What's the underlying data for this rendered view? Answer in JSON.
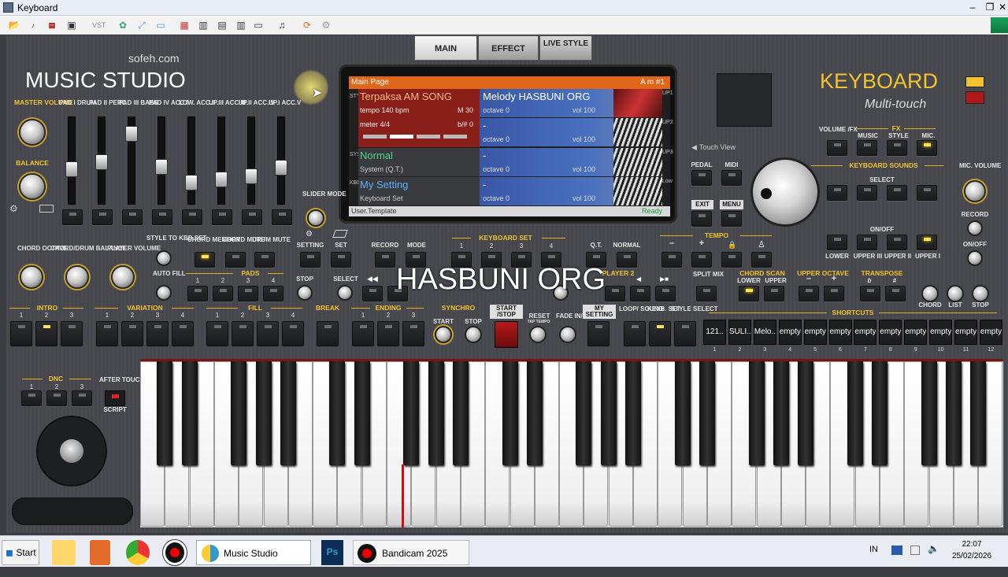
{
  "window": {
    "title": "Keyboard",
    "minimize": "–",
    "restore": "❐",
    "close": "✕"
  },
  "toolbar": {
    "vst": "VST"
  },
  "branding": {
    "site": "sofeh.com",
    "app": "MUSIC STUDIO",
    "keyboard": "KEYBOARD",
    "multitouch": "Multi-touch"
  },
  "tabs": {
    "main": "MAIN",
    "effect": "EFFECT",
    "live_style": "LIVE STYLE"
  },
  "screen": {
    "header": "Main Page",
    "chord": "A m  #1",
    "style_name": "Terpaksa AM SONG",
    "tempo": "tempo 140 bpm",
    "measure": "M 30",
    "meter": "meter 4/4",
    "beat": "b/# 0",
    "normal": "Normal",
    "system": "System (Q.T.)",
    "my_setting": "My Setting",
    "kbd_set": "Keyboard Set",
    "footer_left": "User.Template",
    "footer_right": "Ready",
    "upper": [
      {
        "name": "Melody HASBUNI ORG",
        "octave": "octave 0",
        "vol": "vol 100",
        "side": "UP1"
      },
      {
        "name": "-",
        "octave": "octave 0",
        "vol": "vol 100",
        "side": "UP2"
      },
      {
        "name": "-",
        "octave": "octave 0",
        "vol": "vol 100",
        "side": "UP3"
      },
      {
        "name": "-",
        "octave": "octave 0",
        "vol": "vol 100",
        "side": "Low"
      }
    ],
    "side_style": "STYLE",
    "side_sys": "SYS",
    "side_kbd": "KBD"
  },
  "mixer": {
    "master_volume": "MASTER VOLUME",
    "balance": "BALANCE",
    "channels": [
      "PAD I DRUM",
      "PAD II PERC",
      "PAD III BASS",
      "PAD IV ACC.I",
      "LOW. ACC.II",
      "UP.III ACC.III",
      "UP.II ACC.IV",
      "UP.I ACC.V"
    ],
    "slider_mode": "SLIDER MODE"
  },
  "controls": {
    "chord_octave": "CHORD OCTAVE",
    "chord_drum_balance": "CHORD/DRUM BALANCE",
    "player_volume": "PLAYER VOLUME",
    "style_to_kbd_set": "STYLE TO KBD SET",
    "auto_fill": "AUTO FILL",
    "chord_memory": "CHORD MEMORY",
    "chord_mute": "CHORD MUTE",
    "drum_mute": "DRUM MUTE",
    "setting": "SETTING",
    "set": "SET",
    "record": "RECORD",
    "mode": "MODE",
    "keyboard_set": "KEYBOARD SET",
    "qt": "Q.T.",
    "normal": "NORMAL",
    "tempo": "TEMPO",
    "minus": "–",
    "plus": "+",
    "pads": "PADS",
    "stop": "STOP",
    "select": "SELECT",
    "player2": "PLAYER 2",
    "split_mix": "SPLIT MIX",
    "chord_scan": "CHORD SCAN",
    "lower": "LOWER",
    "upper": "UPPER",
    "upper_octave": "UPPER OCTAVE",
    "transpose": "TRANSPOSE",
    "flat": "b",
    "sharp": "#",
    "intro": "INTRO",
    "variation": "VARIATION",
    "fill": "FILL",
    "break": "BREAK",
    "ending": "ENDING",
    "synchro": "SYNCHRO",
    "start": "START",
    "start_stop": "START /STOP",
    "reset": "RESET",
    "tap_tempo": "TAP TEMPO",
    "fade_in_out": "FADE IN/OUT",
    "my_setting": "MY SETTING",
    "loop_sound": "LOOP/ SOUND",
    "keyb_set": "KEYB. SET",
    "style_select": "STYLE SELECT",
    "shortcuts": "SHORTCUTS",
    "chord": "CHORD",
    "list": "LIST",
    "dnc": "DNC",
    "after_touch": "AFTER TOUCH",
    "script": "SCRIPT",
    "pedal": "PEDAL",
    "midi": "MIDI",
    "exit": "EXIT",
    "menu": "MENU",
    "touch_view": "Touch View",
    "volume_fx": "VOLUME /FX",
    "fx": "FX",
    "music": "MUSIC",
    "style": "STYLE",
    "mic": "MIC.",
    "keyboard_sounds": "KEYBOARD SOUNDS",
    "on_off": "ON/OFF",
    "lower_label": "LOWER",
    "upper3": "UPPER III",
    "upper2": "UPPER II",
    "upper1": "UPPER I",
    "mic_volume": "MIC. VOLUME",
    "record_r": "RECORD",
    "on_off_r": "ON/OFF",
    "n1": "1",
    "n2": "2",
    "n3": "3",
    "n4": "4"
  },
  "shortcuts": [
    {
      "label": "121..",
      "n": "1"
    },
    {
      "label": "SULI..",
      "n": "2"
    },
    {
      "label": "Melo..",
      "n": "3"
    },
    {
      "label": "empty",
      "n": "4"
    },
    {
      "label": "empty",
      "n": "5"
    },
    {
      "label": "empty",
      "n": "6"
    },
    {
      "label": "empty",
      "n": "7"
    },
    {
      "label": "empty",
      "n": "8"
    },
    {
      "label": "empty",
      "n": "9"
    },
    {
      "label": "empty",
      "n": "10"
    },
    {
      "label": "empty",
      "n": "11"
    },
    {
      "label": "empty",
      "n": "12"
    }
  ],
  "watermark": "HASBUNI ORG",
  "taskbar": {
    "start": "Start",
    "music_studio": "Music Studio",
    "bandicam": "Bandicam 2025",
    "lang": "IN",
    "time": "22:07",
    "date": "25/02/2026",
    "ps": "Ps"
  },
  "colors": {
    "accent_yellow": "#f2c230",
    "screen_orange": "#e0661a",
    "screen_blue": "#3957a6",
    "led_on": "#ffe35a"
  }
}
